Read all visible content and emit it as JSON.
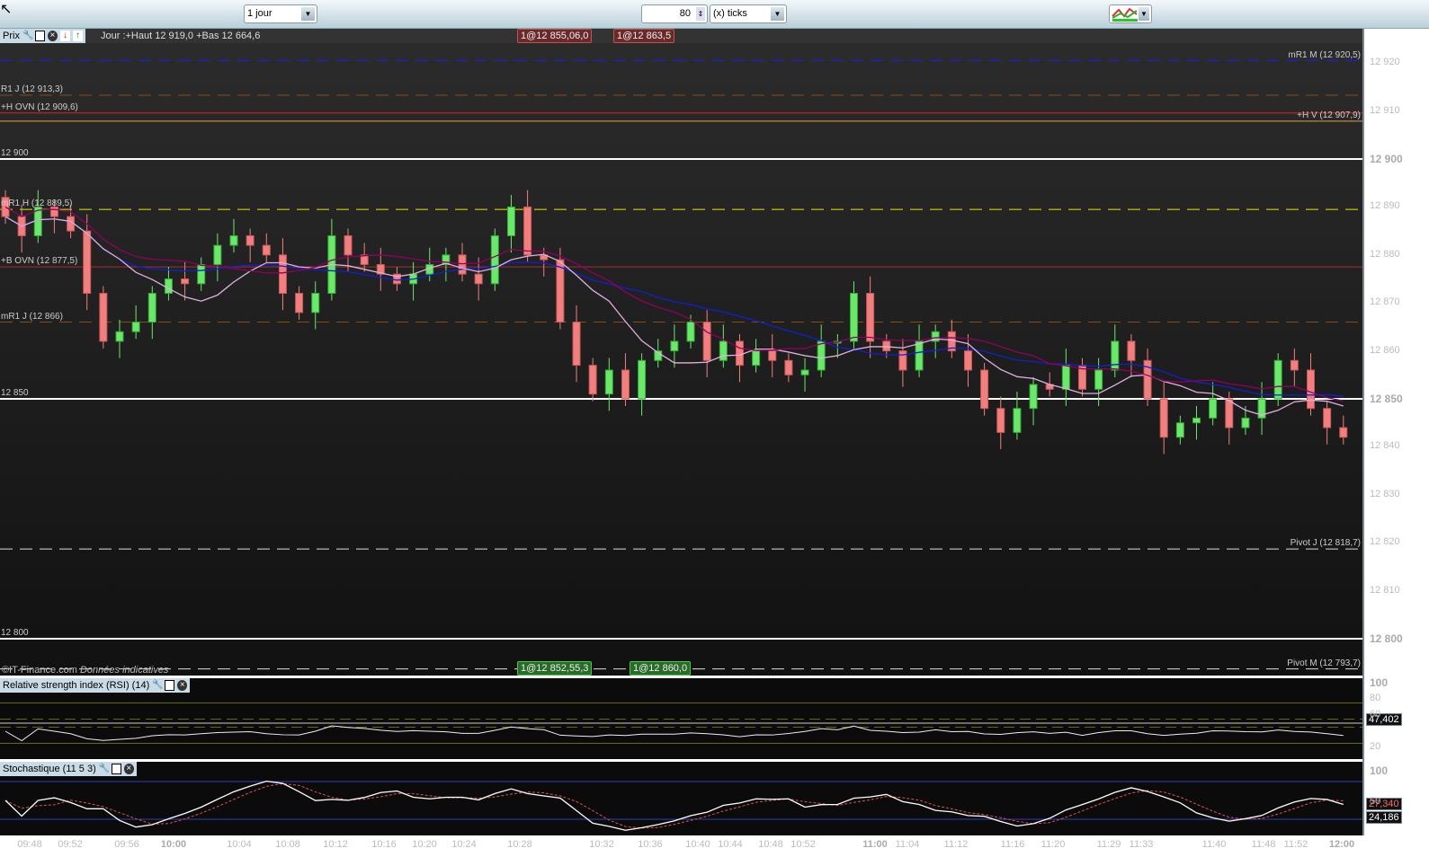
{
  "toolbar": {
    "period": "1 jour",
    "units": "80",
    "unit_type": "(x) ticks",
    "indicator_button": "add-indicator-icon"
  },
  "price_panel": {
    "tag": "Prix",
    "info": "Jour :+Haut 12 919,0 +Bas 12 664,6",
    "copyright": "©IT-Finance.com",
    "disclaimer": "Données indicatives",
    "orders_top": [
      {
        "label": "1@12 855,0",
        "extra": "6,0"
      },
      {
        "label": "1@12 863,5"
      }
    ],
    "orders_bottom": [
      {
        "label": "1@12 852,5",
        "extra": "5,3"
      },
      {
        "label": "1@12 860,0"
      }
    ]
  },
  "levels": [
    {
      "label": "mR1 M (12 920,5)",
      "price": 12920.5,
      "color": "#1a1aff",
      "style": "dash",
      "side": "right"
    },
    {
      "label": "R1 J (12 913,3)",
      "price": 12913.3,
      "color": "#8a4a10",
      "style": "dash",
      "side": "left"
    },
    {
      "label": "+H OVN (12 909,6)",
      "price": 12909.6,
      "color": "#e02020",
      "style": "solid",
      "side": "left"
    },
    {
      "label": "+H V (12 907,9)",
      "price": 12907.9,
      "color": "#e0a040",
      "style": "solid",
      "side": "right"
    },
    {
      "label": "12 900",
      "price": 12900,
      "color": "#ffffff",
      "style": "solid",
      "side": "left"
    },
    {
      "label": "mR1 H (12 889,5)",
      "price": 12889.5,
      "color": "#e8e800",
      "style": "dash",
      "side": "left"
    },
    {
      "label": "+B OVN (12 877,5)",
      "price": 12877.5,
      "color": "#a03030",
      "style": "solid",
      "side": "left"
    },
    {
      "label": "mR1 J (12 866)",
      "price": 12866,
      "color": "#8a4a10",
      "style": "dash",
      "side": "left"
    },
    {
      "label": "12 850",
      "price": 12850,
      "color": "#ffffff",
      "style": "solid",
      "side": "left"
    },
    {
      "label": "Pivot J (12 818,7)",
      "price": 12818.7,
      "color": "#dddddd",
      "style": "dash",
      "side": "right"
    },
    {
      "label": "12 800",
      "price": 12800,
      "color": "#ffffff",
      "style": "solid",
      "side": "left"
    },
    {
      "label": "Pivot M (12 793,7)",
      "price": 12793.7,
      "color": "#dddddd",
      "style": "dash",
      "side": "right"
    }
  ],
  "price_axis": [
    "12 920",
    "12 910",
    "12 900",
    "12 890",
    "12 880",
    "12 870",
    "12 860",
    "12 850",
    "12 840",
    "12 830",
    "12 820",
    "12 810",
    "12 800"
  ],
  "closes": [
    12888,
    12884,
    12890,
    12888,
    12885,
    12872,
    12862,
    12864,
    12866,
    12872,
    12875,
    12874,
    12878,
    12882,
    12884,
    12882,
    12880,
    12872,
    12868,
    12872,
    12884,
    12880,
    12878,
    12876,
    12874,
    12876,
    12878,
    12880,
    12876,
    12874,
    12884,
    12890,
    12880,
    12879,
    12866,
    12857,
    12851,
    12856,
    12850,
    12858,
    12860,
    12862,
    12866,
    12858,
    12862,
    12857,
    12860,
    12858,
    12855,
    12856,
    12862,
    12862,
    12872,
    12862,
    12860,
    12856,
    12862,
    12864,
    12860,
    12856,
    12848,
    12843,
    12848,
    12853,
    12852,
    12857,
    12852,
    12856,
    12862,
    12858,
    12850,
    12842,
    12845,
    12846,
    12850,
    12844,
    12846,
    12850,
    12858,
    12856,
    12848,
    12844,
    12842
  ],
  "rsi": {
    "tag": "Relative strength index (RSI) (14)",
    "value": "47,402",
    "axis": [
      "100",
      "80",
      "60",
      "20"
    ]
  },
  "stoch": {
    "tag": "Stochastique (11 5 3)",
    "value1": "27,340",
    "value2": "24,186",
    "axis": [
      "100",
      "50"
    ]
  },
  "times": [
    "09:48",
    "09:52",
    "09:56",
    "10:00",
    "10:04",
    "10:08",
    "10:12",
    "10:16",
    "10:20",
    "10:24",
    "10:28",
    "10:32",
    "10:36",
    "10:40",
    "10:44",
    "10:48",
    "10:52",
    "11:00",
    "11:04",
    "11:12",
    "11:16",
    "11:20",
    "11:29",
    "11:33",
    "11:40",
    "11:48",
    "11:52",
    "12:00"
  ]
}
